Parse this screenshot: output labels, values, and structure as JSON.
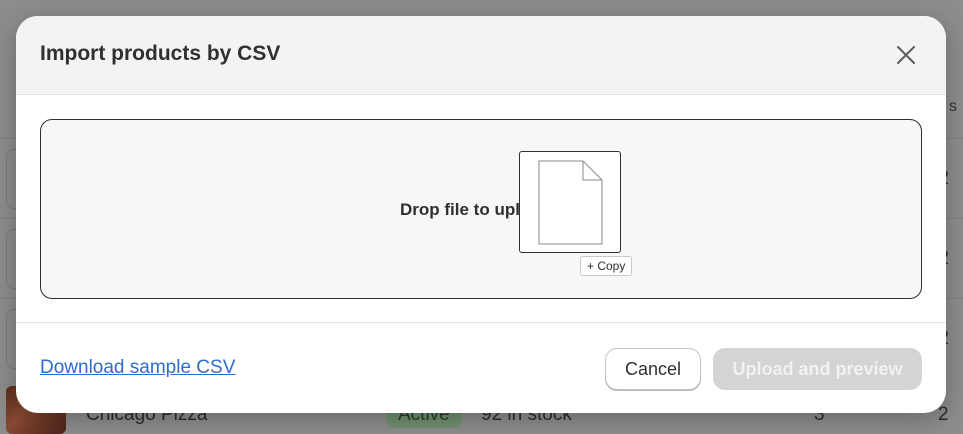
{
  "background": {
    "rows": [
      {
        "qty": "2"
      },
      {
        "qty": "2"
      },
      {
        "qty": "2"
      }
    ],
    "last_row": {
      "name": "Chicago Pizza",
      "status": "Active",
      "stock": "92 in stock",
      "qty": "3",
      "qty2": "2"
    },
    "header_letter": "s"
  },
  "modal": {
    "title": "Import products by CSV",
    "close_icon": "close-icon",
    "dropzone": {
      "text": "Drop file to upload",
      "copy_label": "+ Copy",
      "file_icon": "file-icon"
    },
    "footer": {
      "sample_link": "Download sample CSV",
      "cancel_label": "Cancel",
      "upload_label": "Upload and preview"
    }
  },
  "colors": {
    "link": "#2c6ecb",
    "upload_disabled_bg": "#d4d4d4",
    "status_badge": "#6f8f6f"
  }
}
